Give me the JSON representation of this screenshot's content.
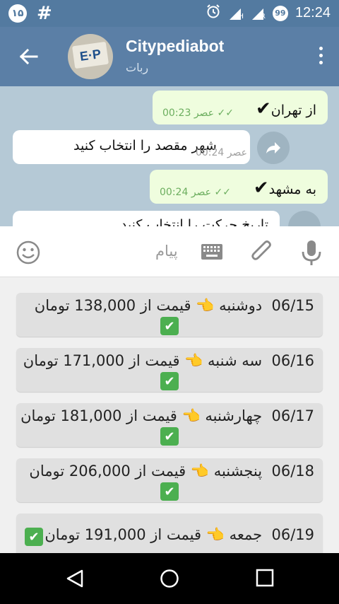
{
  "statusbar": {
    "badge": "۱۵",
    "hash": "#",
    "h_label": "H",
    "r_label": "R",
    "notif_badge": "99",
    "time": "12:24"
  },
  "appbar": {
    "title": "Citypediabot",
    "subtitle": "ربات",
    "avatar_text": "E·P"
  },
  "messages": [
    {
      "dir": "out",
      "text": "از تهران",
      "time": "00:23",
      "period": "عصر",
      "check": "✔"
    },
    {
      "dir": "in",
      "text": "شهر مقصد را انتخاب کنید",
      "time": "00:24",
      "period": "عصر"
    },
    {
      "dir": "out",
      "text": "به مشهد",
      "time": "00:24",
      "period": "عصر",
      "check": "✔"
    },
    {
      "dir": "in",
      "text": "تاریخ حرکت را انتخاب کنید"
    }
  ],
  "input": {
    "placeholder": "پیام"
  },
  "keyboard_buttons": [
    {
      "date": "06/15",
      "day": "دوشنبه",
      "price_text": "قیمت از 138,000 تومان",
      "pointer": "👈",
      "check": "✔"
    },
    {
      "date": "06/16",
      "day": "سه شنبه",
      "price_text": "قیمت از 171,000 تومان",
      "pointer": "👈",
      "check": "✔"
    },
    {
      "date": "06/17",
      "day": "چهارشنبه",
      "price_text": "قیمت از 181,000 تومان",
      "pointer": "👈",
      "check": "✔"
    },
    {
      "date": "06/18",
      "day": "پنجشنبه",
      "price_text": "قیمت از 206,000 تومان",
      "pointer": "👈",
      "check": "✔"
    },
    {
      "date": "06/19",
      "day": "جمعه",
      "price_text": "قیمت از 191,000 تومان",
      "pointer": "👈",
      "check": "✔"
    }
  ],
  "colors": {
    "header": "#5b7fa6",
    "outgoing_bubble": "#effdde",
    "check_green": "#4caf50"
  }
}
